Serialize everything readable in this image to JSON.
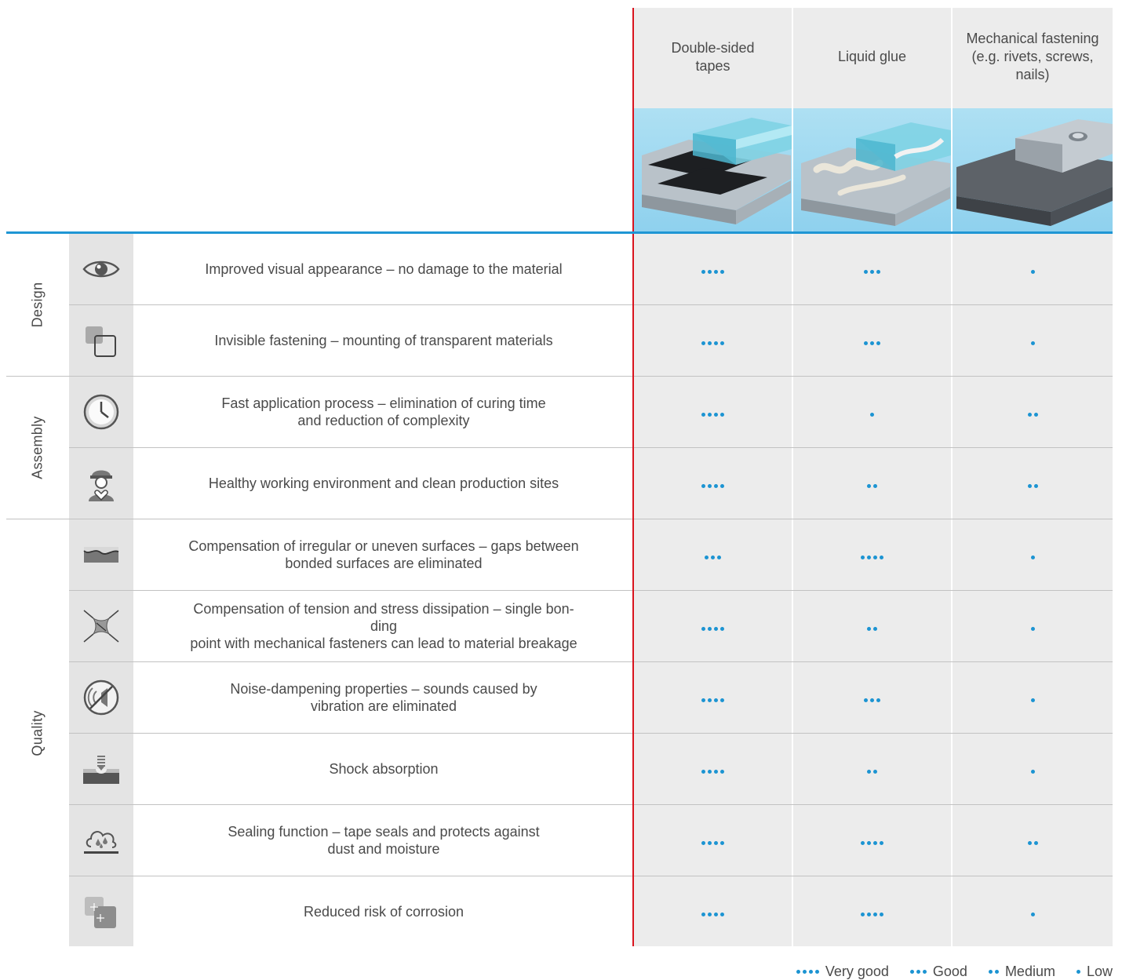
{
  "columns": [
    {
      "label": "Double-sided tapes"
    },
    {
      "label": "Liquid glue"
    },
    {
      "label": "Mechanical fastening (e.g. rivets, screws, nails)"
    }
  ],
  "categories": [
    {
      "label": "Design"
    },
    {
      "label": "Assembly"
    },
    {
      "label": "Quality"
    }
  ],
  "rows": [
    {
      "icon": "eye-icon",
      "text": "Improved visual appearance – no damage to the material",
      "ratings": [
        4,
        3,
        1
      ]
    },
    {
      "icon": "overlapping-squares-icon",
      "text": "Invisible fastening – mounting of transparent materials",
      "ratings": [
        4,
        3,
        1
      ]
    },
    {
      "icon": "clock-icon",
      "text": "Fast application process – elimination of curing time\nand reduction of complexity",
      "ratings": [
        4,
        1,
        2
      ]
    },
    {
      "icon": "worker-heart-icon",
      "text": "Healthy working environment and clean production sites",
      "ratings": [
        4,
        2,
        2
      ]
    },
    {
      "icon": "uneven-surface-icon",
      "text": "Compensation of irregular or uneven surfaces – gaps between\nbonded surfaces are eliminated",
      "ratings": [
        3,
        4,
        1
      ]
    },
    {
      "icon": "stretched-sheet-icon",
      "text": "Compensation of tension and stress dissipation – single bon-\nding\npoint with mechanical fasteners can lead to material breakage",
      "ratings": [
        4,
        2,
        1
      ]
    },
    {
      "icon": "noise-off-icon",
      "text": "Noise-dampening properties – sounds caused by\nvibration are eliminated",
      "ratings": [
        4,
        3,
        1
      ]
    },
    {
      "icon": "shock-absorption-icon",
      "text": "Shock absorption",
      "ratings": [
        4,
        2,
        1
      ]
    },
    {
      "icon": "sealing-drops-icon",
      "text": "Sealing function – tape seals and protects against\ndust and moisture",
      "ratings": [
        4,
        4,
        2
      ]
    },
    {
      "icon": "corrosion-icon",
      "text": "Reduced risk of corrosion",
      "ratings": [
        4,
        4,
        1
      ]
    }
  ],
  "legend": [
    {
      "dots": 4,
      "label": "Very good"
    },
    {
      "dots": 3,
      "label": "Good"
    },
    {
      "dots": 2,
      "label": "Medium"
    },
    {
      "dots": 1,
      "label": "Low"
    }
  ],
  "colors": {
    "accent_blue": "#1c94d2",
    "divider_red": "#d9141e",
    "column_bg": "#ececec",
    "icon_bg": "#e4e4e4"
  }
}
